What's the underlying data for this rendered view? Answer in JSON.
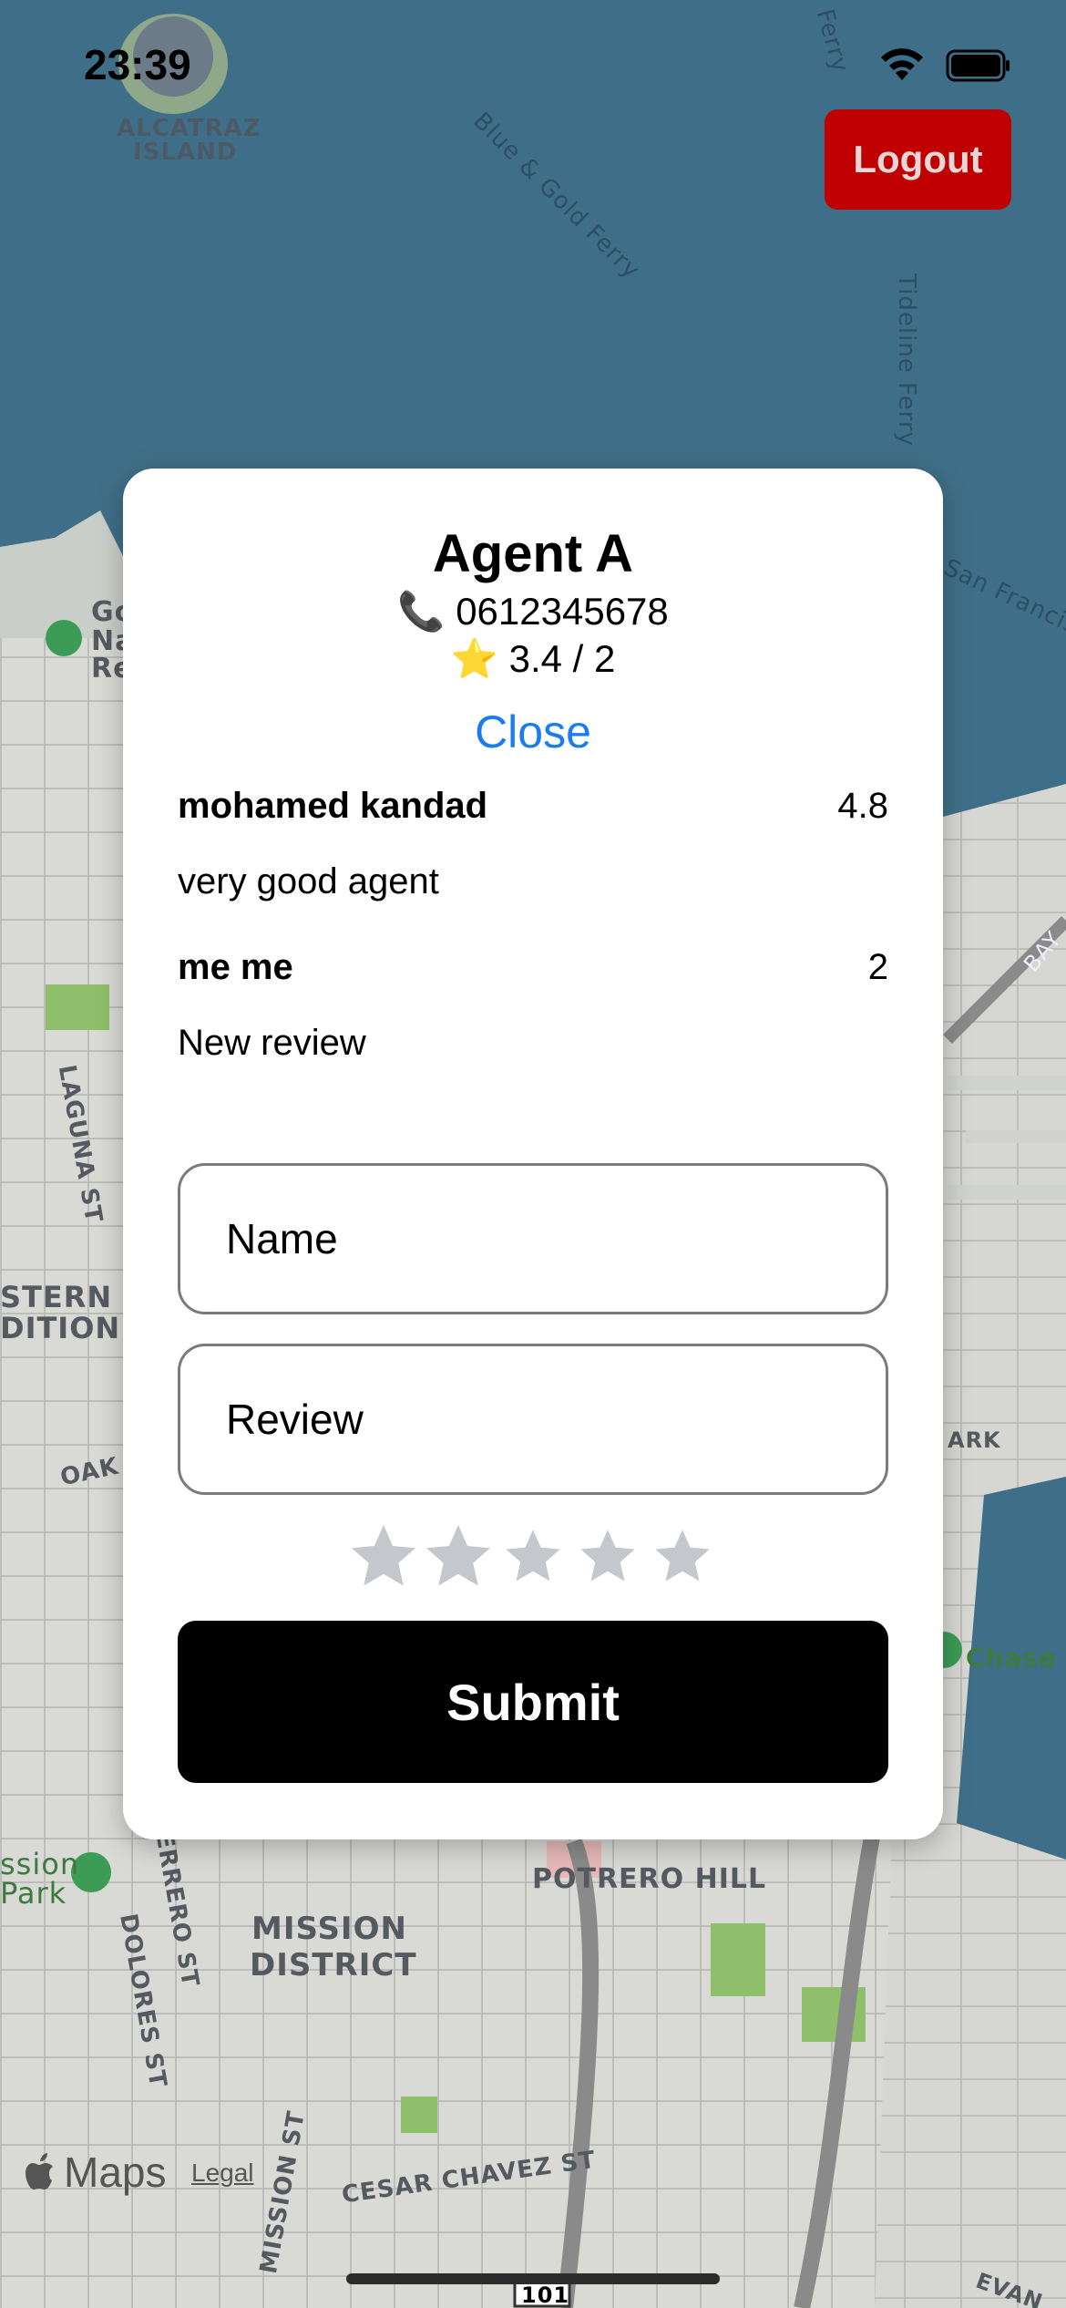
{
  "status_bar": {
    "time": "23:39",
    "icons": [
      "wifi-icon",
      "battery-icon"
    ]
  },
  "header": {
    "logout_label": "Logout"
  },
  "map": {
    "labels": {
      "alcatraz": "ALCATRAZ",
      "island": "ISLAND",
      "blue_gold_ferry": "Blue & Gold Ferry",
      "tideline_ferry": "Tideline Ferry",
      "ferry": "Ferry",
      "san_francisco": "San Francis",
      "laguna": "LAGUNA ST",
      "western": "STERN",
      "addition": "DITION",
      "oak": "OAK",
      "mission_park": "ssion",
      "park": "Park",
      "guerrero": "ERRERO ST",
      "dolores": "DOLORES ST",
      "mission_district_1": "MISSION",
      "mission_district_2": "DISTRICT",
      "potrero_hill": "POTRERO HILL",
      "cesar_chavez": "CESAR CHAVEZ ST",
      "mission_st": "MISSION ST",
      "chase": "Chase C",
      "ark": "ARK",
      "bay": "BAY",
      "evan": "EVAN",
      "golden": "Go",
      "na": "Na",
      "re": "Re",
      "hwy": "101"
    },
    "maps_brand": "Maps",
    "legal_label": "Legal"
  },
  "modal": {
    "agent_name": "Agent A",
    "phone_icon": "📞",
    "phone": "0612345678",
    "rating_icon": "⭐",
    "rating_text": "3.4 / 2",
    "close_label": "Close",
    "reviews": [
      {
        "author": "mohamed kandad",
        "score": "4.8",
        "text": "very good agent"
      },
      {
        "author": "me me",
        "score": "2",
        "text": "New review"
      }
    ],
    "form": {
      "name_placeholder": "Name",
      "review_placeholder": "Review",
      "stars_selected": 0,
      "stars_total": 5,
      "submit_label": "Submit"
    }
  },
  "colors": {
    "accent": "#1a7cf3",
    "logout_bg": "#c00000",
    "star_empty": "#c4c8cc",
    "submit_bg": "#000000"
  }
}
